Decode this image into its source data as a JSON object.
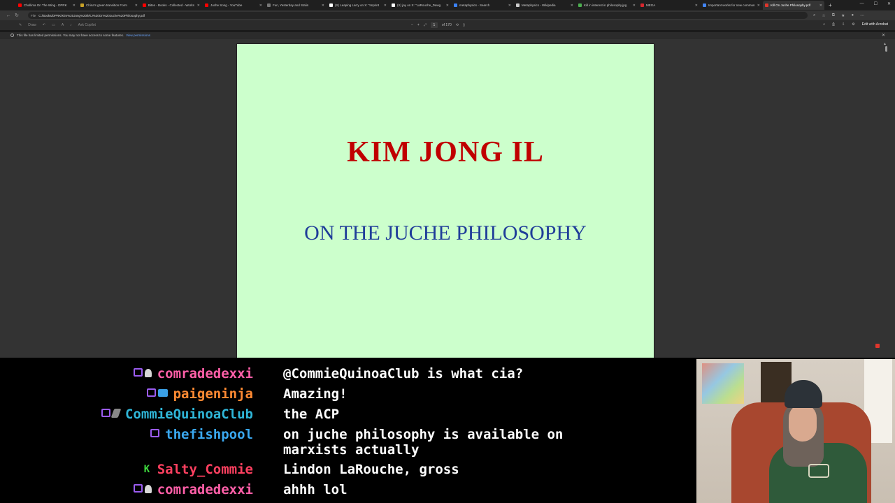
{
  "browser": {
    "tabs": [
      {
        "label": "Chollima On The Wing - DPRK",
        "icon": "youtube-icon",
        "color": "#ff0000"
      },
      {
        "label": "China's green transition Form",
        "icon": "doc-icon",
        "color": "#c9a227"
      },
      {
        "label": "Bites - Books - Collected - Works",
        "icon": "youtube-icon",
        "color": "#ff0000"
      },
      {
        "label": "Juche Song - YouTube",
        "icon": "youtube-icon",
        "color": "#ff0000"
      },
      {
        "label": "Fun, Yesterday and Stalin",
        "icon": "page-icon",
        "color": "#777777"
      },
      {
        "label": "(X) Leaping Larry on X: \"Imprint",
        "icon": "x-icon",
        "color": "#ffffff"
      },
      {
        "label": "(X) jay on X: \"LaRouche_Dawg",
        "icon": "x-icon",
        "color": "#ffffff"
      },
      {
        "label": "metaphysics - Search",
        "icon": "search-icon",
        "color": "#3b82f6"
      },
      {
        "label": "Metaphysics - Wikipedia",
        "icon": "wikipedia-icon",
        "color": "#cccccc"
      },
      {
        "label": "Kill in interest in philosophy.jpg",
        "icon": "image-icon",
        "color": "#4caf50"
      },
      {
        "label": "MEGA",
        "icon": "mega-icon",
        "color": "#d9272e"
      },
      {
        "label": "Important works for new commun",
        "icon": "doc-icon",
        "color": "#4285f4"
      },
      {
        "label": "Kill On Juche Philosophy.pdf",
        "icon": "pdf-icon",
        "color": "#e0362c"
      }
    ],
    "address": {
      "prefix": "File",
      "url": "C:/Books/DPRK/Kim%20Jong%20Il/KJ%20On%20Juche%20Philosophy.pdf"
    }
  },
  "pdf_toolbar": {
    "draw_label": "Draw",
    "ask_copilot": "Ask Copilot",
    "page_current": "1",
    "page_total": "of 170",
    "edit_acrobat": "Edit with Acrobat"
  },
  "notice": {
    "text": "This file has limited permissions. You may not have access to some features.",
    "link": "View permissions"
  },
  "document": {
    "title": "KIM JONG IL",
    "subtitle": "ON THE JUCHE PHILOSOPHY"
  },
  "chat": [
    {
      "nick": "comradedexxi",
      "color": "#ff5fa8",
      "badges": [
        "sub",
        "chess"
      ],
      "text": "@CommieQuinoaClub is what cia?"
    },
    {
      "nick": "paigeninja",
      "color": "#ff8a33",
      "badges": [
        "sub",
        "crown"
      ],
      "text": "Amazing!"
    },
    {
      "nick": "CommieQuinoaClub",
      "color": "#2fb6d8",
      "badges": [
        "sub",
        "pencil"
      ],
      "text": "the ACP"
    },
    {
      "nick": "thefishpool",
      "color": "#3aa8f0",
      "badges": [
        "sub"
      ],
      "text": "on juche philosophy is available on\nmarxists actually"
    },
    {
      "nick": "Salty_Commie",
      "color": "#ff4060",
      "badges": [
        "k"
      ],
      "text": "Lindon LaRouche, gross"
    },
    {
      "nick": "comradedexxi",
      "color": "#ff5fa8",
      "badges": [
        "sub",
        "chess"
      ],
      "text": "ahhh lol"
    }
  ]
}
